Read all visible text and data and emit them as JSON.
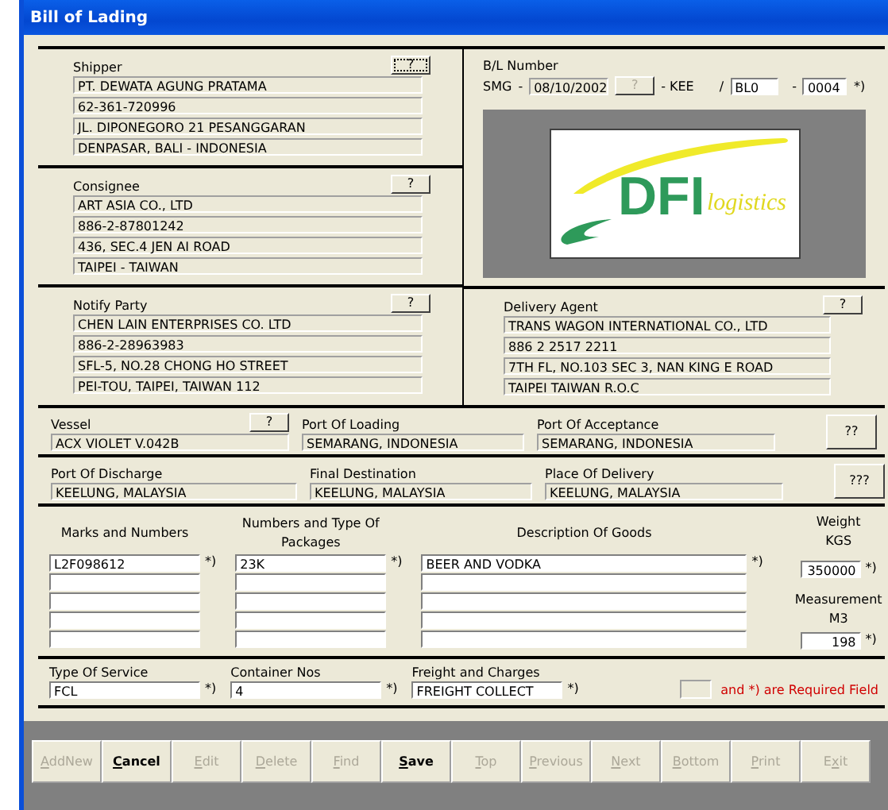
{
  "window": {
    "title": "Bill of Lading"
  },
  "parties": [
    {
      "label": "Shipper",
      "button": "?",
      "focused": true,
      "readonly": true,
      "lines": [
        "PT. DEWATA AGUNG PRATAMA",
        "62-361-720996",
        "JL. DIPONEGORO 21 PESANGGARAN",
        "DENPASAR, BALI - INDONESIA"
      ]
    },
    {
      "label": "Consignee",
      "button": "?",
      "focused": false,
      "readonly": true,
      "lines": [
        "ART ASIA CO., LTD",
        "886-2-87801242",
        "436, SEC.4 JEN AI ROAD",
        "TAIPEI - TAIWAN"
      ]
    },
    {
      "label": "Notify Party",
      "button": "?",
      "focused": false,
      "readonly": true,
      "lines": [
        "CHEN LAIN ENTERPRISES CO. LTD",
        "886-2-28963983",
        "SFL-5, NO.28 CHONG HO STREET",
        "PEI-TOU, TAIPEI, TAIWAN 112"
      ]
    }
  ],
  "bl_number": {
    "label": "B/L Number",
    "prefix": "SMG",
    "sep1": "-",
    "date": "08/10/2002",
    "button": "?",
    "suffix": "- KEE",
    "slash": "/",
    "series": "BL0",
    "sep2": "-",
    "number": "0004",
    "note": "*)"
  },
  "logo": {
    "mark": "DFI",
    "tagline": "logistics"
  },
  "delivery_agent": {
    "label": "Delivery Agent",
    "button": "?",
    "focused": false,
    "readonly": true,
    "lines": [
      "TRANS WAGON INTERNATIONAL CO., LTD",
      "886 2 2517 2211",
      "7TH FL, NO.103 SEC 3, NAN KING E ROAD",
      "TAIPEI TAIWAN R.O.C"
    ]
  },
  "route_rows": [
    {
      "fields": [
        {
          "label": "Vessel",
          "value": "ACX VIOLET V.042B",
          "button": "?"
        },
        {
          "label": "Port Of Loading",
          "value": "SEMARANG, INDONESIA"
        },
        {
          "label": "Port Of Acceptance",
          "value": "SEMARANG, INDONESIA"
        }
      ],
      "button": "??"
    },
    {
      "fields": [
        {
          "label": "Port Of Discharge",
          "value": "KEELUNG, MALAYSIA"
        },
        {
          "label": "Final Destination",
          "value": "KEELUNG, MALAYSIA"
        },
        {
          "label": "Place Of Delivery",
          "value": "KEELUNG, MALAYSIA"
        }
      ],
      "button": "???"
    }
  ],
  "goods": {
    "columns": [
      {
        "header": "Marks and Numbers",
        "value": "L2F098612",
        "note": "*)"
      },
      {
        "header": "Numbers and Type Of Packages",
        "value": "23K",
        "note": "*)"
      },
      {
        "header": "Description Of Goods",
        "value": "BEER AND VODKA",
        "note": "*)"
      }
    ],
    "weight": {
      "label": "Weight",
      "unit": "KGS",
      "value": "350000",
      "note": "*)"
    },
    "measurement": {
      "label": "Measurement",
      "unit": "M3",
      "value": "198",
      "note": "*)"
    }
  },
  "service_fields": [
    {
      "label": "Type Of Service",
      "value": "FCL",
      "note": "*)"
    },
    {
      "label": "Container Nos",
      "value": "4",
      "note": "*)"
    },
    {
      "label": "Freight and Charges",
      "value": "FREIGHT COLLECT",
      "note": "*)"
    }
  ],
  "legend": "and  *)  are Required Field",
  "buttons": [
    {
      "hotkey": "A",
      "rest": "ddNew",
      "disabled": true
    },
    {
      "hotkey": "C",
      "rest": "ancel",
      "disabled": false
    },
    {
      "hotkey": "E",
      "rest": "dit",
      "disabled": true
    },
    {
      "hotkey": "D",
      "rest": "elete",
      "disabled": true
    },
    {
      "hotkey": "F",
      "rest": "ind",
      "disabled": true
    },
    {
      "hotkey": "S",
      "rest": "ave",
      "disabled": false
    },
    {
      "hotkey": "T",
      "rest": "op",
      "disabled": true
    },
    {
      "hotkey": "P",
      "rest": "revious",
      "disabled": true
    },
    {
      "hotkey": "N",
      "rest": "ext",
      "disabled": true
    },
    {
      "hotkey": "B",
      "rest": "ottom",
      "disabled": true
    },
    {
      "hotkey": "P",
      "rest": "rint",
      "disabled": true
    },
    {
      "before": "E",
      "hotkey": "x",
      "rest": "it",
      "disabled": true
    }
  ]
}
